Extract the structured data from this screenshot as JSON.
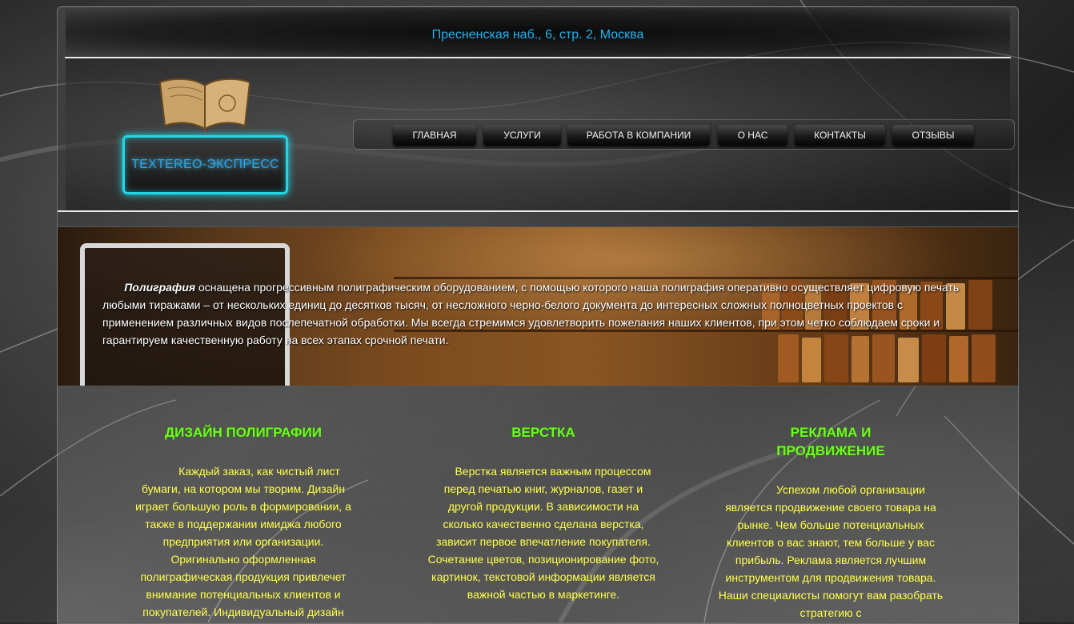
{
  "header": {
    "address": "Пресненская наб., 6, стр. 2, Москва",
    "logo_text": "TEXTEREO-ЭКСПРЕСС"
  },
  "nav": {
    "items": [
      {
        "label": "ГЛАВНАЯ"
      },
      {
        "label": "УСЛУГИ"
      },
      {
        "label": "РАБОТА В КОМПАНИИ"
      },
      {
        "label": "О НАС"
      },
      {
        "label": "КОНТАКТЫ"
      },
      {
        "label": "ОТЗЫВЫ"
      }
    ]
  },
  "banner": {
    "lead_bold": "Полиграфия",
    "text": " оснащена прогрессивным полиграфическим оборудованием, с помощью которого наша полиграфия оперативно осуществляет цифровую печать любыми тиражами – от нескольких единиц до десятков тысяч, от несложного черно-белого документа до интересных сложных полноцветных проектов с применением различных видов послепечатной обработки. Мы всегда стремимся удовлетворить пожелания наших клиентов, при этом четко соблюдаем сроки и гарантируем качественную работу на всех этапах срочной печати."
  },
  "columns": [
    {
      "title": "ДИЗАЙН ПОЛИГРАФИИ",
      "body": "Каждый заказ, как чистый лист бумаги, на котором мы творим. Дизайн играет большую роль в формировании, а также в поддержании имиджа любого предприятия или организации. Оригинально оформленная полиграфическая продукция привлечет внимание потенциальных клиентов и покупателей. Индивидуальный дизайн"
    },
    {
      "title": "ВЕРСТКА",
      "body": "Верстка является важным процессом перед печатью книг, журналов, газет и другой продукции. В зависимости на сколько качественно сделана верстка, зависит первое впечатление покупателя. Сочетание цветов, позиционирование фото, картинок, текстовой информации является важной частью в маркетинге."
    },
    {
      "title": "РЕКЛАМА И ПРОДВИЖЕНИЕ",
      "body": "Успехом любой организации является продвижение своего товара на рынке. Чем больше потенциальных клиентов о вас знают, тем больше у вас прибыль. Реклама является лучшим инструментом для продвижения товара. Наши специалисты помогут вам разобрать стратегию с"
    }
  ],
  "colors": {
    "address": "#1fb3f0",
    "logo_border": "#22d6e6",
    "column_title": "#6dfa23",
    "column_body": "#ffff4d"
  },
  "icons": [
    "open-book-logo-icon"
  ]
}
